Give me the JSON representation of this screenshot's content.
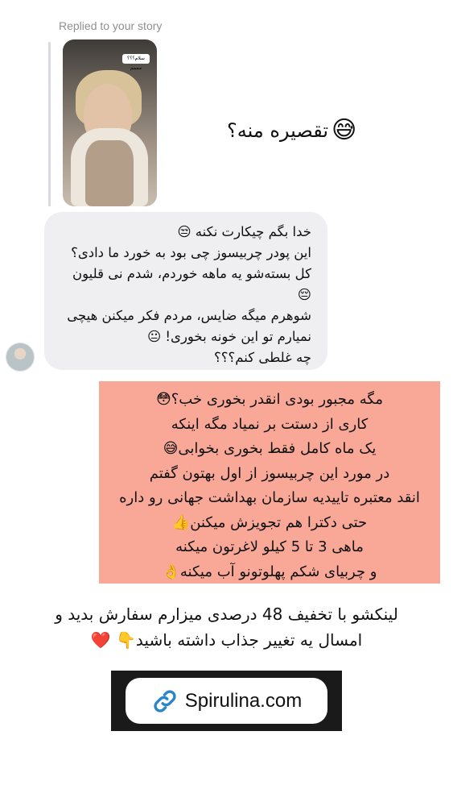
{
  "reply_header": "Replied to your story",
  "story_sticker": "سلام؟؟؟مممم",
  "story_caption": "تقصیره منه؟",
  "story_caption_emoji": "😅",
  "incoming_message": {
    "lines": [
      "خدا بگم چیکارت نکنه 😒",
      "این پودر چربیسوز چی بود به خورد ما دادی؟",
      "کل بسته‌شو یه ماهه خوردم، شدم نی قلیون",
      "😔",
      "شوهرم میگه ضایس، مردم فکر میکنن هیچی",
      "نمیارم تو این خونه بخوری! 😐",
      "چه غلطی کنم؟؟؟"
    ]
  },
  "reply_block": {
    "lines": [
      "مگه مجبور بودی انقدر بخوری خب؟😳",
      "کاری از دستت بر نمیاد مگه اینکه",
      "یک ماه کامل فقط بخوری بخوابی😅",
      "در مورد این چربیسوز از اول بهتون گفتم",
      "انقد معتبره تاییدیه سازمان بهداشت جهانی رو داره",
      "حتی دکترا هم تجویزش میکنن👍",
      "ماهی 3 تا 5  کیلو لاغرتون میکنه",
      "و چربیای شکم پهلوتونو آب میکنه👌"
    ],
    "background": "#f9a898"
  },
  "promo": {
    "lines": [
      "لینکشو با تخفیف 48 درصدی میزارم سفارش بدید و",
      "امسال یه تغییر جذاب داشته باشید👇 ❤️"
    ]
  },
  "link": {
    "icon": "link-icon",
    "label": "Spirulina.com",
    "accent": "#2a85c9"
  }
}
